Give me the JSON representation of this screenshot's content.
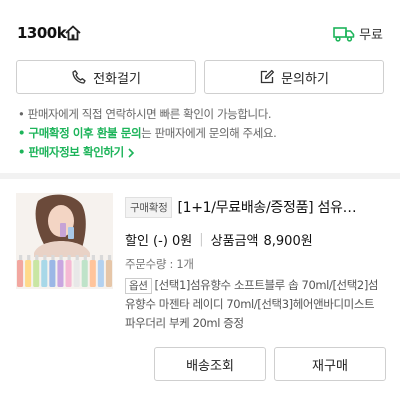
{
  "store": {
    "name": "1300k"
  },
  "delivery": {
    "label": "무료"
  },
  "contact": {
    "call_label": "전화걸기",
    "inquiry_label": "문의하기"
  },
  "notices": {
    "line1": "• 판매자에게 직접 연락하시면 빠른 확인이 가능합니다.",
    "line2_highlight": "• 구매확정 이후 환불 문의",
    "line2_rest": "는 판매자에게 문의해 주세요.",
    "link": "• 판매자정보 확인하기"
  },
  "order": {
    "status_badge": "구매확정",
    "title": "[1+1/무료배송/증정품] 섬유…",
    "discount": "할인 (-) 0원",
    "price_label": "상품금액",
    "price_value": "8,900원",
    "quantity": "주문수량 : 1개",
    "option_badge": "옵션",
    "option_text": "[선택1]섬유향수 소프트블루 솝 70ml/[선택2]섬유향수 마젠타 레이디 70ml/[선택3]헤어앤바디미스트 파우더리 부케 20ml 증정",
    "track_label": "배송조회",
    "reorder_label": "재구매"
  },
  "colors": {
    "accent_green": "#1db45a",
    "bottle_colors": [
      "#f2a7a0",
      "#ffd98a",
      "#c9e6a3",
      "#a8d8e8",
      "#9bb7e6",
      "#c9a6e0",
      "#f5b9d4",
      "#e8e8e8",
      "#bfe3c9",
      "#ffc49b",
      "#b3d1f0",
      "#e6c6a8"
    ]
  },
  "icons": {
    "home": "home-icon",
    "truck": "truck-icon",
    "phone": "phone-icon",
    "edit": "edit-icon",
    "chevron": "chevron-right-icon"
  }
}
